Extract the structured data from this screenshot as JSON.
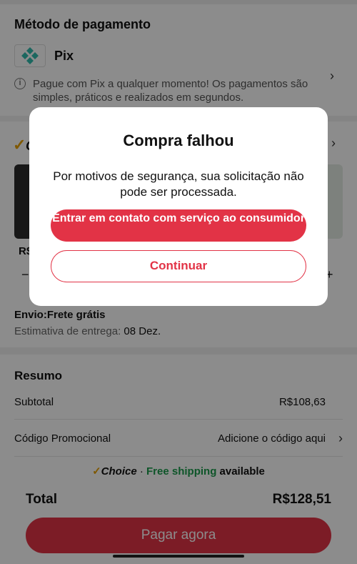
{
  "payment": {
    "title": "Método de pagamento",
    "method_label": "Pix",
    "info_text": "Pague com Pix a qualquer momento! Os pagamentos são simples, práticos e realizados em segundos."
  },
  "items": {
    "choice_fragment": "C",
    "price_fragment": "R$",
    "shipping": "Envio:Frete grátis",
    "estimate_label": "Estimativa de entrega:",
    "estimate_date": "08 Dez."
  },
  "summary": {
    "title": "Resumo",
    "subtotal_label": "Subtotal",
    "subtotal_value": "R$108,63",
    "promo_label": "Código Promocional",
    "promo_action": "Adicione o código aqui",
    "choice_brand": "Choice",
    "choice_sep": " · ",
    "free_shipping": "Free shipping",
    "available": " available",
    "total_label": "Total",
    "total_value": "R$128,51",
    "pay_button": "Pagar agora"
  },
  "modal": {
    "title": "Compra falhou",
    "message": "Por motivos de segurança, sua solicitação não pode ser processada.",
    "contact_button": "Entrar em contato com serviço ao consumidor",
    "continue_button": "Continuar"
  },
  "colors": {
    "accent": "#e23346",
    "choice": "#e8a100",
    "free": "#1a9c4b",
    "pix": "#32bcad"
  }
}
